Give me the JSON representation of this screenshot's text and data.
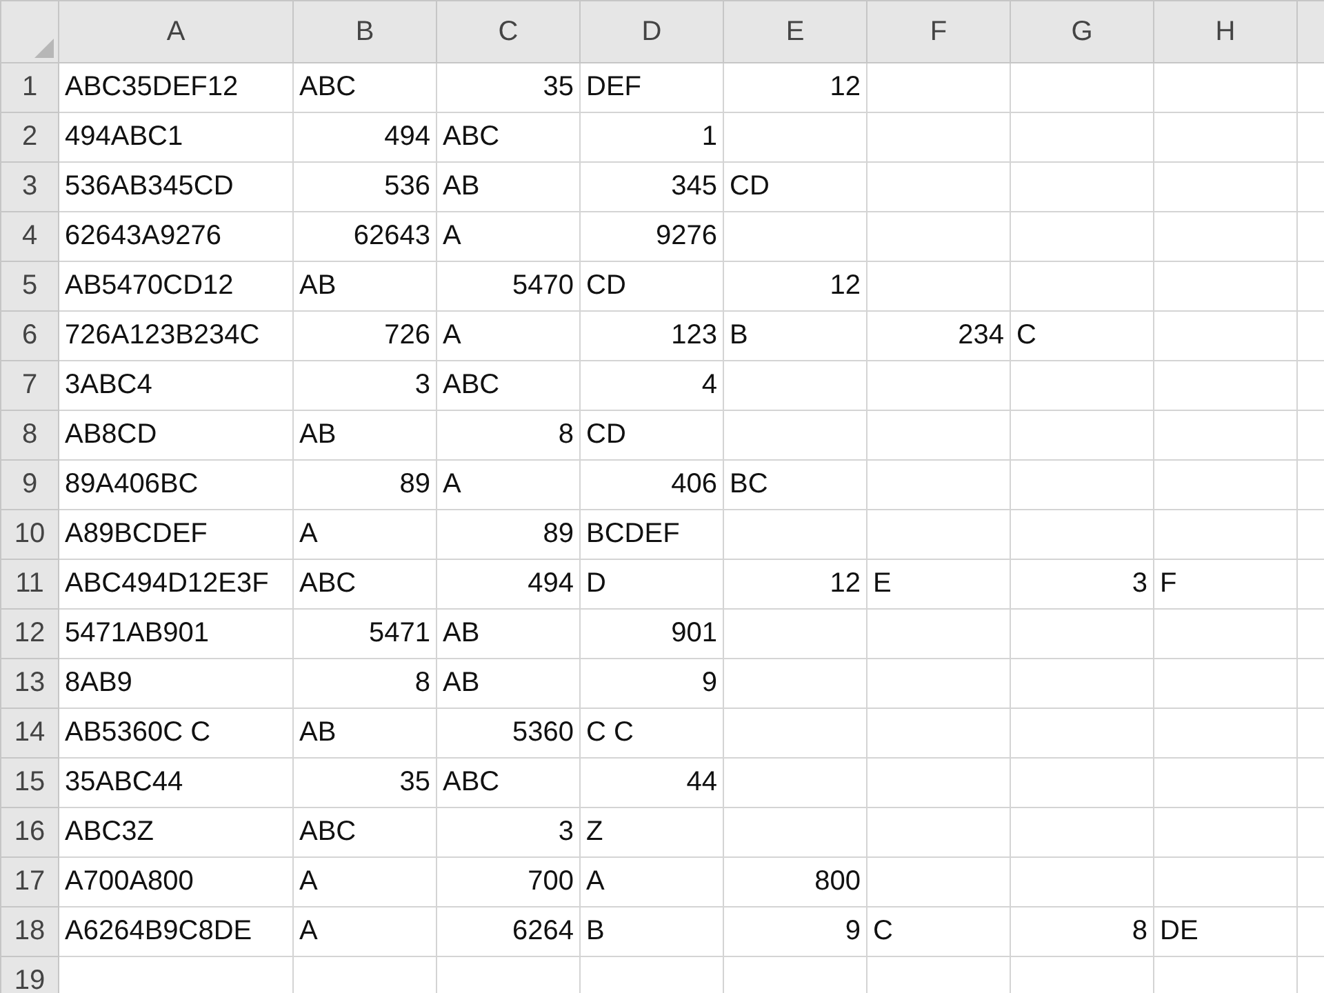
{
  "columns": [
    "A",
    "B",
    "C",
    "D",
    "E",
    "F",
    "G",
    "H"
  ],
  "rows": [
    {
      "header": "1",
      "cells": [
        {
          "text": "ABC35DEF12",
          "kind": "text"
        },
        {
          "text": "ABC",
          "kind": "text"
        },
        {
          "text": "35",
          "kind": "number"
        },
        {
          "text": "DEF",
          "kind": "text"
        },
        {
          "text": "12",
          "kind": "number"
        }
      ]
    },
    {
      "header": "2",
      "cells": [
        {
          "text": "494ABC1",
          "kind": "text"
        },
        {
          "text": "494",
          "kind": "number"
        },
        {
          "text": "ABC",
          "kind": "text"
        },
        {
          "text": "1",
          "kind": "number"
        }
      ]
    },
    {
      "header": "3",
      "cells": [
        {
          "text": "536AB345CD",
          "kind": "text"
        },
        {
          "text": "536",
          "kind": "number"
        },
        {
          "text": "AB",
          "kind": "text"
        },
        {
          "text": "345",
          "kind": "number"
        },
        {
          "text": "CD",
          "kind": "text"
        }
      ]
    },
    {
      "header": "4",
      "cells": [
        {
          "text": "62643A9276",
          "kind": "text"
        },
        {
          "text": "62643",
          "kind": "number"
        },
        {
          "text": "A",
          "kind": "text"
        },
        {
          "text": "9276",
          "kind": "number"
        }
      ]
    },
    {
      "header": "5",
      "cells": [
        {
          "text": "AB5470CD12",
          "kind": "text"
        },
        {
          "text": "AB",
          "kind": "text"
        },
        {
          "text": "5470",
          "kind": "number"
        },
        {
          "text": "CD",
          "kind": "text"
        },
        {
          "text": "12",
          "kind": "number"
        }
      ]
    },
    {
      "header": "6",
      "cells": [
        {
          "text": "726A123B234C",
          "kind": "text"
        },
        {
          "text": "726",
          "kind": "number"
        },
        {
          "text": "A",
          "kind": "text"
        },
        {
          "text": "123",
          "kind": "number"
        },
        {
          "text": "B",
          "kind": "text"
        },
        {
          "text": "234",
          "kind": "number"
        },
        {
          "text": "C",
          "kind": "text"
        }
      ]
    },
    {
      "header": "7",
      "cells": [
        {
          "text": "3ABC4",
          "kind": "text"
        },
        {
          "text": "3",
          "kind": "number"
        },
        {
          "text": "ABC",
          "kind": "text"
        },
        {
          "text": "4",
          "kind": "number"
        }
      ]
    },
    {
      "header": "8",
      "cells": [
        {
          "text": "AB8CD",
          "kind": "text"
        },
        {
          "text": "AB",
          "kind": "text"
        },
        {
          "text": "8",
          "kind": "number"
        },
        {
          "text": "CD",
          "kind": "text"
        }
      ]
    },
    {
      "header": "9",
      "cells": [
        {
          "text": "89A406BC",
          "kind": "text"
        },
        {
          "text": "89",
          "kind": "number"
        },
        {
          "text": "A",
          "kind": "text"
        },
        {
          "text": "406",
          "kind": "number"
        },
        {
          "text": "BC",
          "kind": "text"
        }
      ]
    },
    {
      "header": "10",
      "cells": [
        {
          "text": "A89BCDEF",
          "kind": "text"
        },
        {
          "text": "A",
          "kind": "text"
        },
        {
          "text": "89",
          "kind": "number"
        },
        {
          "text": "BCDEF",
          "kind": "text"
        }
      ]
    },
    {
      "header": "11",
      "cells": [
        {
          "text": "ABC494D12E3F",
          "kind": "text"
        },
        {
          "text": "ABC",
          "kind": "text"
        },
        {
          "text": "494",
          "kind": "number"
        },
        {
          "text": "D",
          "kind": "text"
        },
        {
          "text": "12",
          "kind": "number"
        },
        {
          "text": "E",
          "kind": "text"
        },
        {
          "text": "3",
          "kind": "number"
        },
        {
          "text": "F",
          "kind": "text"
        }
      ]
    },
    {
      "header": "12",
      "cells": [
        {
          "text": "5471AB901",
          "kind": "text"
        },
        {
          "text": "5471",
          "kind": "number"
        },
        {
          "text": "AB",
          "kind": "text"
        },
        {
          "text": "901",
          "kind": "number"
        }
      ]
    },
    {
      "header": "13",
      "cells": [
        {
          "text": "8AB9",
          "kind": "text"
        },
        {
          "text": "8",
          "kind": "number"
        },
        {
          "text": "AB",
          "kind": "text"
        },
        {
          "text": "9",
          "kind": "number"
        }
      ]
    },
    {
      "header": "14",
      "cells": [
        {
          "text": "AB5360C C",
          "kind": "text"
        },
        {
          "text": "AB",
          "kind": "text"
        },
        {
          "text": "5360",
          "kind": "number"
        },
        {
          "text": "C C",
          "kind": "text"
        }
      ]
    },
    {
      "header": "15",
      "cells": [
        {
          "text": "35ABC44",
          "kind": "text"
        },
        {
          "text": "35",
          "kind": "number"
        },
        {
          "text": "ABC",
          "kind": "text"
        },
        {
          "text": "44",
          "kind": "number"
        }
      ]
    },
    {
      "header": "16",
      "cells": [
        {
          "text": "ABC3Z",
          "kind": "text"
        },
        {
          "text": "ABC",
          "kind": "text"
        },
        {
          "text": "3",
          "kind": "number"
        },
        {
          "text": "Z",
          "kind": "text"
        }
      ]
    },
    {
      "header": "17",
      "cells": [
        {
          "text": "A700A800",
          "kind": "text"
        },
        {
          "text": "A",
          "kind": "text"
        },
        {
          "text": "700",
          "kind": "number"
        },
        {
          "text": "A",
          "kind": "text"
        },
        {
          "text": "800",
          "kind": "number"
        }
      ]
    },
    {
      "header": "18",
      "cells": [
        {
          "text": "A6264B9C8DE",
          "kind": "text"
        },
        {
          "text": "A",
          "kind": "text"
        },
        {
          "text": "6264",
          "kind": "number"
        },
        {
          "text": "B",
          "kind": "text"
        },
        {
          "text": "9",
          "kind": "number"
        },
        {
          "text": "C",
          "kind": "text"
        },
        {
          "text": "8",
          "kind": "number"
        },
        {
          "text": "DE",
          "kind": "text"
        }
      ]
    },
    {
      "header": "19"
    }
  ]
}
